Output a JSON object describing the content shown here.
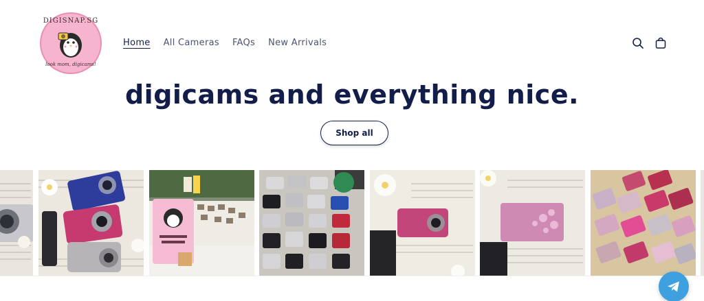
{
  "brand": {
    "logo_text_top": "DIGISNAP.SG",
    "logo_text_bottom": "look mom, digicams!",
    "logo_bg": "#f7b4cf"
  },
  "nav": {
    "items": [
      {
        "label": "Home",
        "active": true
      },
      {
        "label": "All Cameras",
        "active": false
      },
      {
        "label": "FAQs",
        "active": false
      },
      {
        "label": "New Arrivals",
        "active": false
      }
    ]
  },
  "header_icons": [
    "search-icon",
    "cart-icon"
  ],
  "hero": {
    "heading": "digicams and everything nice.",
    "button_label": "Shop all"
  },
  "gallery": {
    "tiles": [
      "silver-camera-photo",
      "blue-pink-silver-sony-cameras-photo",
      "market-stall-sign-photo",
      "camera-collection-grid-photo",
      "pink-camera-on-book-photo",
      "pink-floral-camera-photo",
      "pink-cameras-grid-photo"
    ]
  },
  "chat_widget": {
    "icon": "telegram-icon",
    "color": "#3fa0e0"
  },
  "colors": {
    "navy": "#121d4a",
    "nav_gray": "#4a5375"
  }
}
